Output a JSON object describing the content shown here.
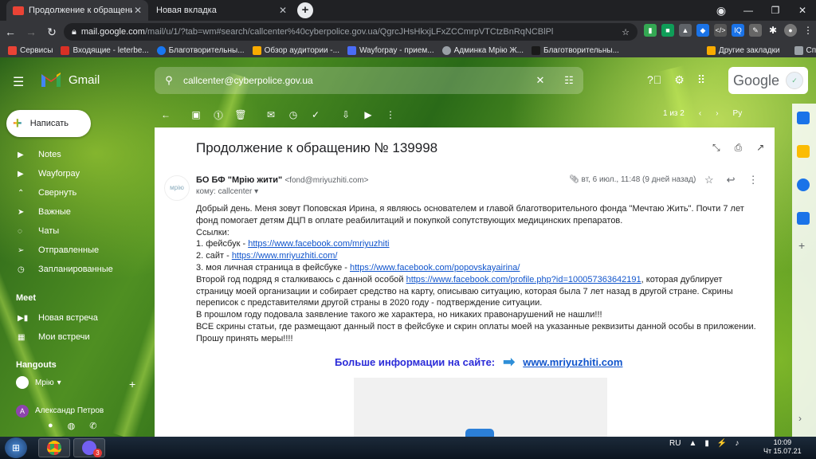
{
  "browser": {
    "tabs": [
      {
        "title": "Продолжение к обращению №",
        "active": true
      },
      {
        "title": "Новая вкладка",
        "active": false
      }
    ],
    "url_host": "mail.google.com",
    "url_path": "/mail/u/1/?tab=wm#search/callcenter%40cyberpolice.gov.ua/QgrcJHsHkxjLFxZCCmrpVTCtzBnRqNCBlPl",
    "bookmarks": [
      {
        "label": "Сервисы",
        "color": "#ea4335"
      },
      {
        "label": "Входящие - leterbe...",
        "color": "#d93025"
      },
      {
        "label": "Благотворительны...",
        "color": "#1877f2"
      },
      {
        "label": "Обзор аудитории -...",
        "color": "#f9ab00"
      },
      {
        "label": "Wayforpay - прием...",
        "color": "#4a6cf7"
      },
      {
        "label": "Админка Мрію Ж...",
        "color": "#9aa0a6"
      },
      {
        "label": "Благотворительны...",
        "color": "#1a1a1a"
      },
      {
        "label": "Другие закладки",
        "color": "#f9ab00"
      },
      {
        "label": "Список для чтения",
        "color": "#9aa0a6"
      }
    ]
  },
  "gmail": {
    "logo_text": "Gmail",
    "search_value": "callcenter@cyberpolice.gov.ua",
    "account_label": "Google",
    "compose_label": "Написать",
    "sidebar": [
      {
        "label": "Notes",
        "icon": "label-icon"
      },
      {
        "label": "Wayforpay",
        "icon": "label-icon"
      },
      {
        "label": "Свернуть",
        "icon": "chevron-up-icon"
      },
      {
        "label": "Важные",
        "icon": "important-icon"
      },
      {
        "label": "Чаты",
        "icon": "chat-icon"
      },
      {
        "label": "Отправленные",
        "icon": "send-icon"
      },
      {
        "label": "Запланированные",
        "icon": "scheduled-icon"
      }
    ],
    "meet_title": "Meet",
    "meet_items": [
      {
        "label": "Новая встреча",
        "icon": "video-icon"
      },
      {
        "label": "Мои встречи",
        "icon": "calendar-icon"
      }
    ],
    "hangouts_title": "Hangouts",
    "hangouts_user": "Мрію",
    "contact_initial": "А",
    "contact_name": "Александр Петров",
    "pager": "1 из 2",
    "lang": "Ру"
  },
  "email": {
    "subject": "Продолжение к обращению № 139998",
    "sender_name": "БО БФ \"Мрію жити\"",
    "sender_email": "<fond@mriyuzhiti.com>",
    "to_line": "кому: callcenter",
    "date": "вт, 6 июл., 11:48 (9 дней назад)",
    "avatar_text": "мрію",
    "body": {
      "p1": "Добрый день. Меня зовут Поповская Ирина, я являюсь основателем и главой благотворительного фонда \"Мечтаю Жить\". Почти 7 лет фонд помогает детям ДЦП в оплате реабилитаций и покупкой сопутствующих медицинских препаратов.",
      "links_title": "Ссылки:",
      "l1_label": "1. фейсбук - ",
      "l1_url": "https://www.facebook.com/mriyuzhiti",
      "l2_label": "2. сайт - ",
      "l2_url": "https://www.mriyuzhiti.com/",
      "l3_label": "3. моя личная страница в фейсбуке - ",
      "l3_url": "https://www.facebook.com/popovskayairina/",
      "p2_a": "Второй год подряд я сталкиваюсь с данной особой ",
      "p2_url": "https://www.facebook.com/profile.php?id=100057363642191",
      "p2_b": ", которая дублирует страницу моей организации и собирает средство на карту, описываю ситуацию, которая была 7 лет назад в другой стране. Скрины переписок с представителями другой страны в 2020 году - подтверждение ситуации.",
      "p3": "В прошлом году подовала заявление такого же характера, но никаких правонарушений не нашли!!!",
      "p4": "ВСЕ скрины статьи, где размещают данный пост в фейсбуке и скрин оплаты моей на указанные реквизиты данной особы в приложении. Прошу принять меры!!!!"
    },
    "promo_text": "Больше информации на сайте:",
    "promo_url": "www.mriyuzhiti.com"
  },
  "taskbar": {
    "lang": "RU",
    "time": "10:09",
    "date": "Чт 15.07.21",
    "viber_badge": "3"
  }
}
